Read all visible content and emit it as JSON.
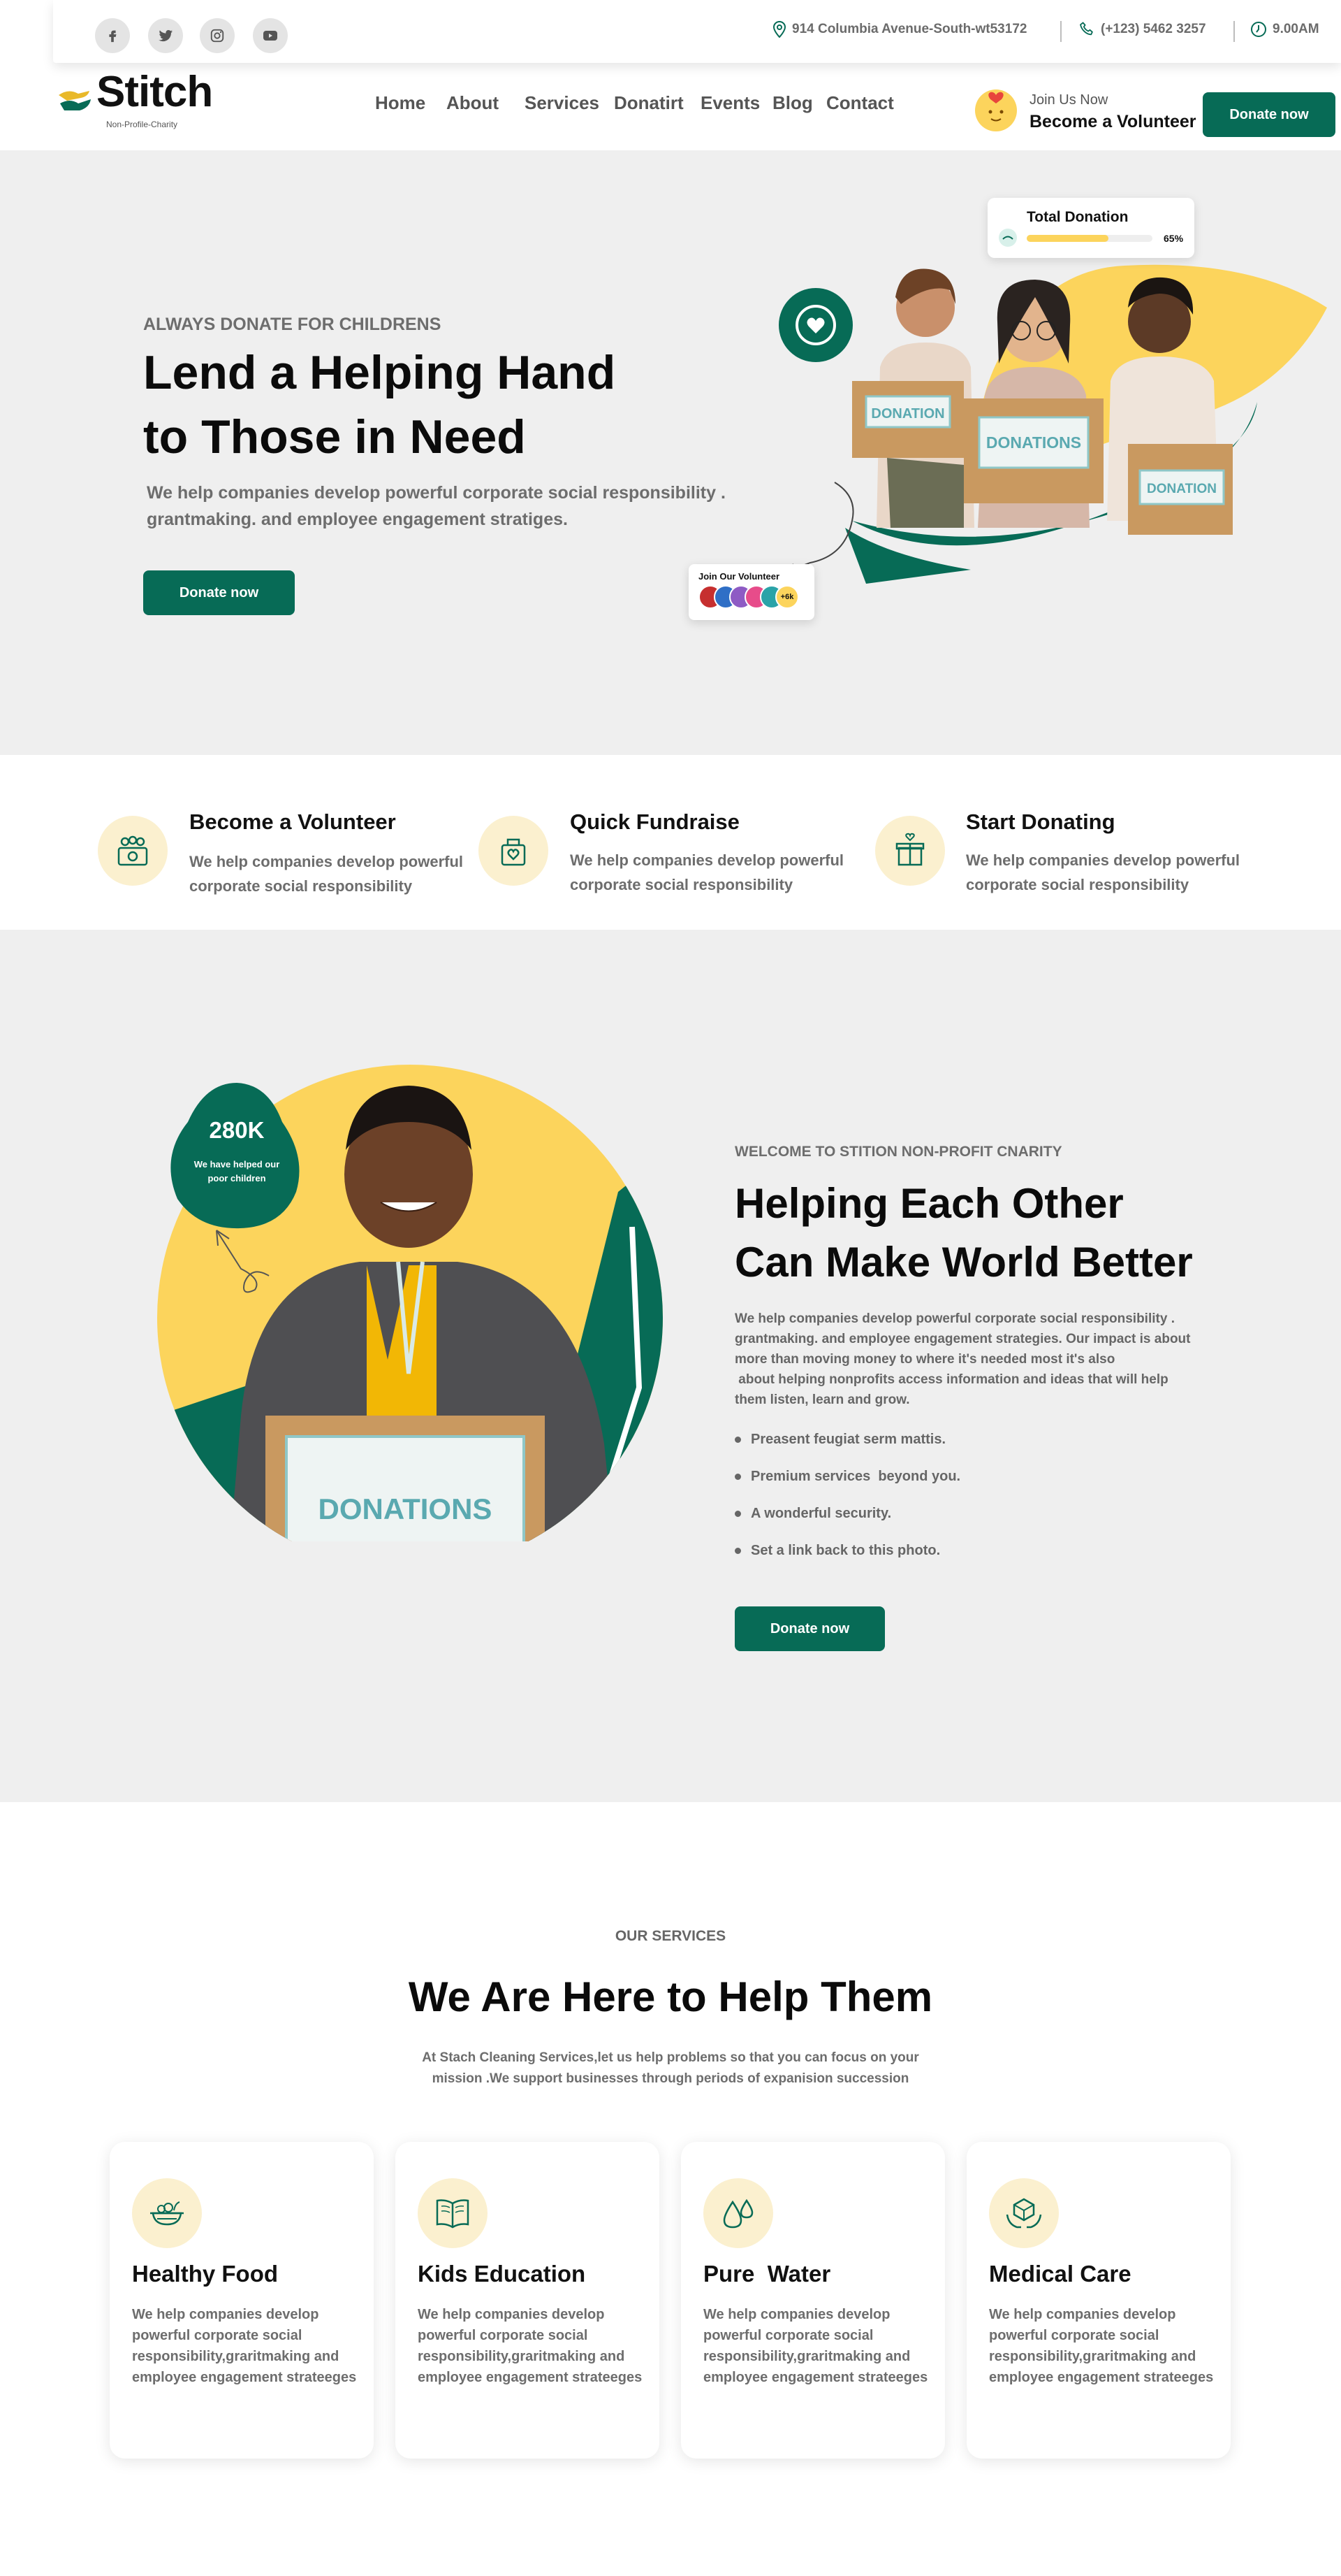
{
  "social": {
    "icons": [
      "facebook-icon",
      "twitter-icon",
      "instagram-icon",
      "youtube-icon"
    ]
  },
  "topbar": {
    "address": "914 Columbia Avenue-South-wt53172",
    "phone": "(+123) 5462 3257",
    "time": "9.00AM"
  },
  "brand": {
    "name": "Stitch",
    "tagline": "Non-Profile-Charity",
    "primary_color": "#076b56",
    "accent_color": "#fcd45c"
  },
  "nav": {
    "items": [
      "Home",
      "About",
      "Services",
      "Donatirt",
      "Events",
      "Blog",
      "Contact"
    ],
    "join_top": "Join Us Now",
    "join_main": "Become a Volunteer",
    "donate_label": "Donate now"
  },
  "hero": {
    "eyebrow": "ALWAYS DONATE FOR CHILDRENS",
    "title_line1": "Lend a Helping Hand",
    "title_line2": "to Those in Need",
    "desc_line1": "We help companies develop powerful corporate social responsibility .",
    "desc_line2": "grantmaking. and employee engagement stratiges.",
    "button": "Donate now",
    "total_donation_label": "Total Donation",
    "total_donation_percent": "65%",
    "total_donation_fraction": 0.65,
    "volunteer_label": "Join Our Volunteer",
    "volunteer_more": "+6k",
    "box_labels": [
      "DONATION",
      "DONATIONS",
      "DONATION"
    ]
  },
  "features": [
    {
      "icon": "volunteer-group-icon",
      "title": "Become a Volunteer",
      "line1": "We help companies develop powerful",
      "line2": "corporate social responsibility"
    },
    {
      "icon": "fundraise-box-icon",
      "title": "Quick Fundraise",
      "line1": "We help companies develop powerful",
      "line2": "corporate social responsibility"
    },
    {
      "icon": "gift-heart-icon",
      "title": "Start Donating",
      "line1": "We help companies develop powerful",
      "line2": "corporate social responsibility"
    }
  ],
  "about": {
    "stat_value": "280K",
    "stat_line1": "We have helped our",
    "stat_line2": "poor children",
    "box_label": "DONATIONS",
    "eyebrow": "WELCOME TO STITION NON-PROFIT CNARITY",
    "title_line1": "Helping Each Other",
    "title_line2": "Can Make World Better",
    "para_lines": [
      "We help companies develop powerful corporate social responsibility .",
      "grantmaking. and employee engagement strategies. Our impact is about",
      "more than moving money to where it's needed most it's also",
      " about helping nonprofits access information and ideas that will help",
      "them listen, learn and grow."
    ],
    "bullets": [
      "Preasent feugiat serm mattis.",
      "Premium services  beyond you.",
      "A wonderful security.",
      "Set a link back to this photo."
    ],
    "button": "Donate now"
  },
  "services": {
    "eyebrow": "OUR SERVICES",
    "title": "We Are Here to Help Them",
    "sub_line1": "At Stach Cleaning Services,let us help problems so that you can focus on your",
    "sub_line2": "mission .We support businesses through periods of expanision succession",
    "cards": [
      {
        "icon": "food-bowl-icon",
        "title": "Healthy Food",
        "lines": [
          "We help companies develop",
          "powerful corporate social",
          "responsibility,graritmaking and",
          "employee engagement strateeges"
        ]
      },
      {
        "icon": "book-icon",
        "title": "Kids Education",
        "lines": [
          "We help companies develop",
          "powerful corporate social",
          "responsibility,graritmaking and",
          "employee engagement strateeges"
        ]
      },
      {
        "icon": "water-drops-icon",
        "title": "Pure  Water",
        "lines": [
          "We help companies develop",
          "powerful corporate social",
          "responsibility,graritmaking and",
          "employee engagement strateeges"
        ]
      },
      {
        "icon": "medical-care-icon",
        "title": "Medical Care",
        "lines": [
          "We help companies develop",
          "powerful corporate social",
          "responsibility,graritmaking and",
          "employee engagement strateeges"
        ]
      }
    ]
  }
}
